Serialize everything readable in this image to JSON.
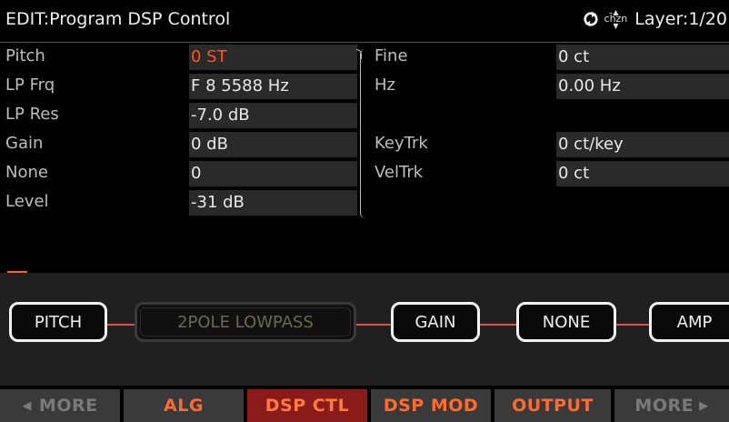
{
  "header": {
    "title": "EDIT:Program DSP Control",
    "layer": "Layer:1/20",
    "chain_text": "ch̄zn",
    "cycle_icon": "cycle-icon"
  },
  "params": {
    "left": [
      {
        "label": "Pitch",
        "value": "0 ST",
        "selected": true
      },
      {
        "label": "LP Frq",
        "value": "F 8 5588 Hz"
      },
      {
        "label": "LP Res",
        "value": "-7.0 dB"
      },
      {
        "label": "Gain",
        "value": "0 dB"
      },
      {
        "label": "None",
        "value": "0"
      },
      {
        "label": "Level",
        "value": "-31 dB"
      }
    ],
    "right": [
      {
        "label": "Fine",
        "value": "0 ct"
      },
      {
        "label": "Hz",
        "value": "0.00 Hz"
      },
      {
        "label": "",
        "value": ""
      },
      {
        "label": "KeyTrk",
        "value": "0 ct/key"
      },
      {
        "label": "VelTrk",
        "value": "0 ct"
      }
    ]
  },
  "algorithm": {
    "blocks": [
      "PITCH",
      "2POLE LOWPASS",
      "GAIN",
      "NONE",
      "AMP"
    ]
  },
  "softbuttons": {
    "more_left": "MORE",
    "alg": "ALG",
    "dsp_ctl": "DSP CTL",
    "dsp_mod": "DSP MOD",
    "output": "OUTPUT",
    "more_right": "MORE"
  },
  "colors": {
    "accent": "#ff5520",
    "active_tab": "#8a1b1b"
  }
}
